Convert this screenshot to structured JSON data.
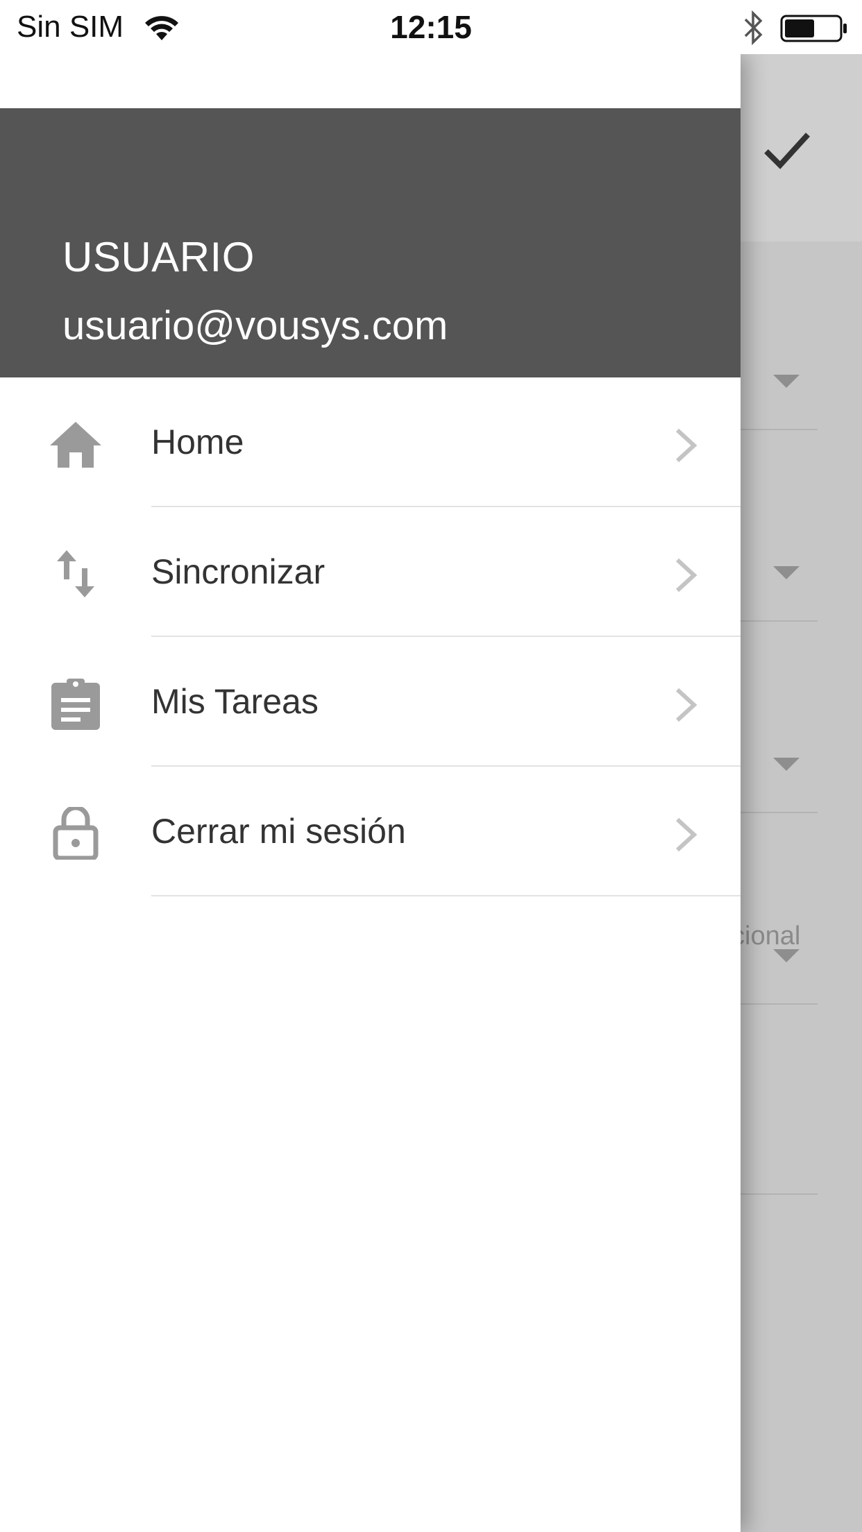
{
  "status_bar": {
    "carrier": "Sin SIM",
    "time": "12:15",
    "wifi_icon": "wifi-icon",
    "bluetooth_icon": "bluetooth-icon",
    "battery_icon": "battery-icon",
    "battery_level": 0.55
  },
  "background": {
    "toolbar_icon": "check-icon",
    "partial_text": "cional"
  },
  "drawer": {
    "user_name": "USUARIO",
    "user_email": "usuario@vousys.com",
    "items": [
      {
        "label": "Home",
        "icon": "home-icon"
      },
      {
        "label": "Sincronizar",
        "icon": "sync-arrows-icon"
      },
      {
        "label": "Mis Tareas",
        "icon": "clipboard-icon"
      },
      {
        "label": "Cerrar mi sesión",
        "icon": "lock-icon"
      }
    ]
  },
  "colors": {
    "header_bg": "#555555",
    "icon_gray": "#9a9a9a",
    "chevron_gray": "#c4c4c4",
    "text_dark": "#333333",
    "overlay_gray": "#c6c6c6"
  }
}
